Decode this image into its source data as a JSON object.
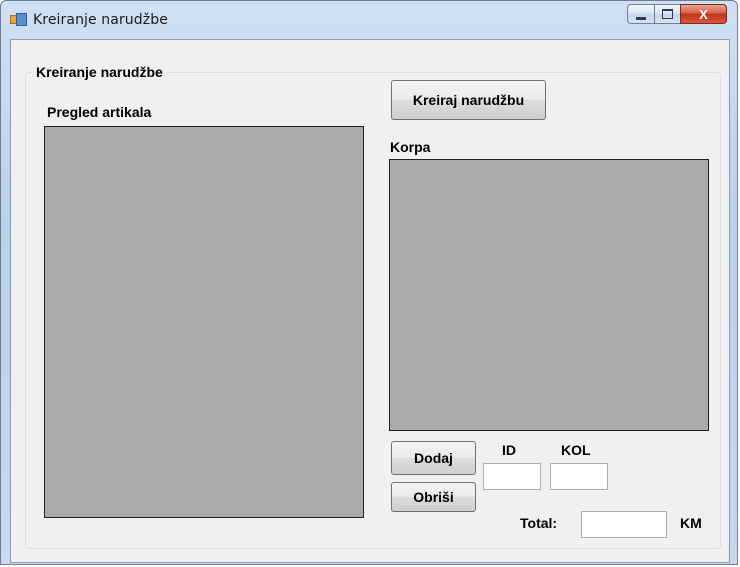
{
  "window": {
    "title": "Kreiranje narudžbe",
    "close_glyph": "X",
    "icons": [
      "app-icon",
      "minimize-icon",
      "maximize-icon",
      "close-icon"
    ]
  },
  "form": {
    "group_title": "Kreiranje narudžbe",
    "articles_label": "Pregled artikala",
    "create_button": "Kreiraj narudžbu",
    "cart_label": "Korpa",
    "add_button": "Dodaj",
    "delete_button": "Obriši",
    "id_label": "ID",
    "id_value": "",
    "qty_label": "KOL",
    "qty_value": "",
    "total_label": "Total:",
    "total_value": "",
    "currency_label": "KM"
  },
  "colors": {
    "listbox_bg": "#aaaaaa",
    "form_bg": "#f0f0f0",
    "close_button": "#c2331a"
  }
}
